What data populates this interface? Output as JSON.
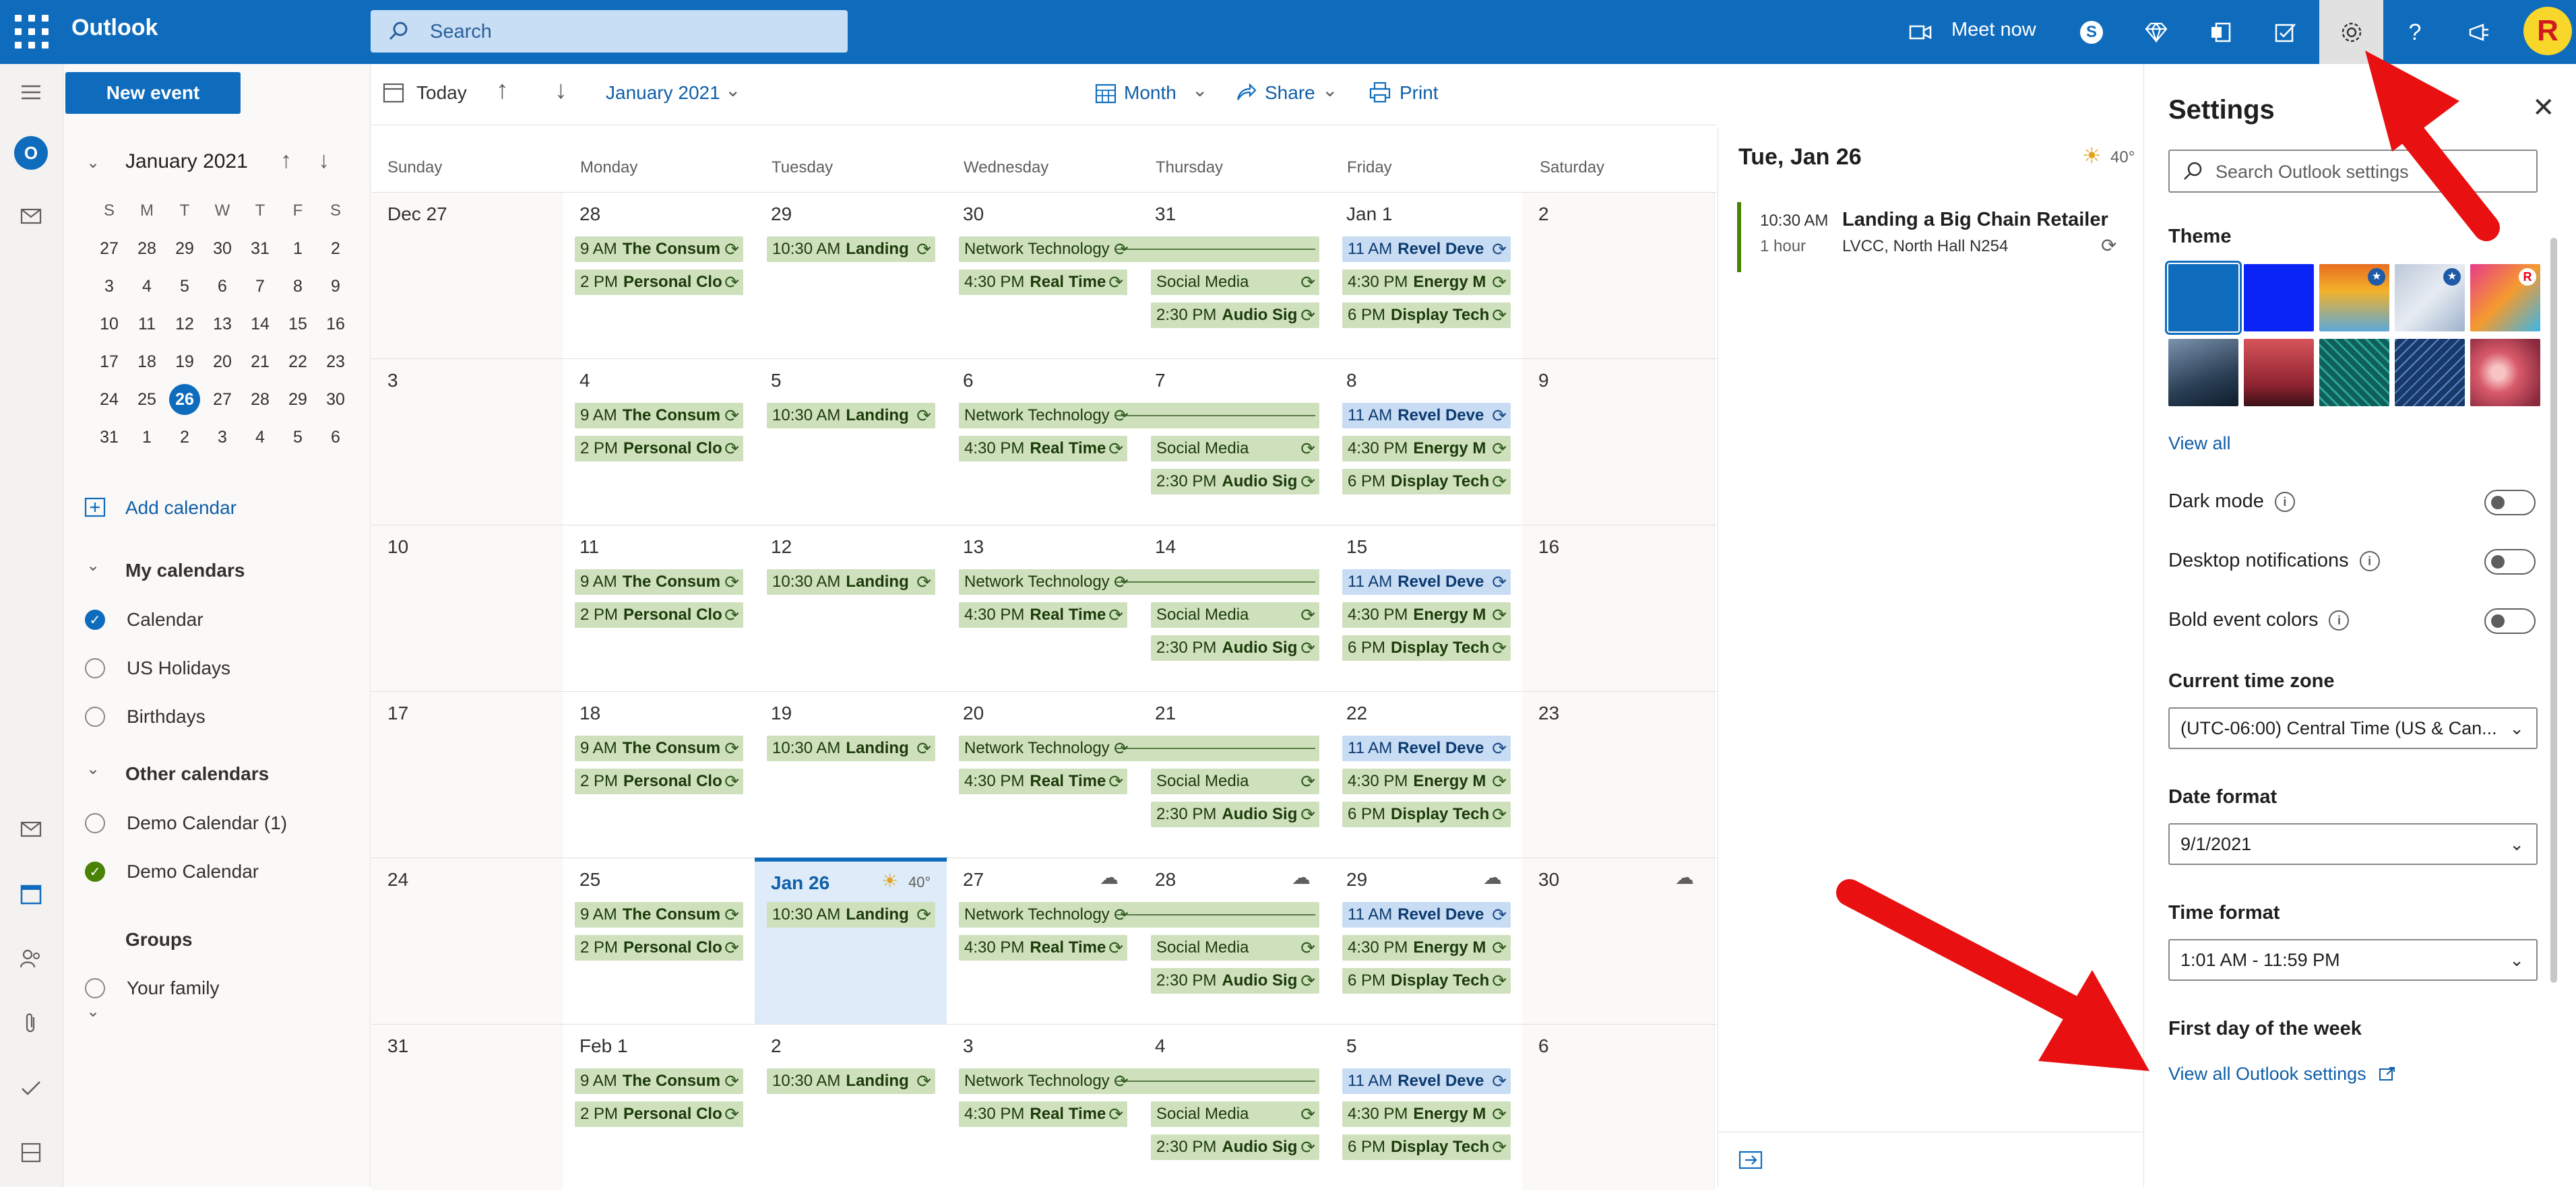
{
  "topbar": {
    "app_name": "Outlook",
    "search_placeholder": "Search",
    "meet_now": "Meet now",
    "avatar_letter": "R"
  },
  "sidebar": {
    "new_event": "New event",
    "mini_title": "January 2021",
    "mini_days": [
      "S",
      "M",
      "T",
      "W",
      "T",
      "F",
      "S"
    ],
    "mini_weeks": [
      [
        "27",
        "28",
        "29",
        "30",
        "31",
        "1",
        "2"
      ],
      [
        "3",
        "4",
        "5",
        "6",
        "7",
        "8",
        "9"
      ],
      [
        "10",
        "11",
        "12",
        "13",
        "14",
        "15",
        "16"
      ],
      [
        "17",
        "18",
        "19",
        "20",
        "21",
        "22",
        "23"
      ],
      [
        "24",
        "25",
        "26",
        "27",
        "28",
        "29",
        "30"
      ],
      [
        "31",
        "1",
        "2",
        "3",
        "4",
        "5",
        "6"
      ]
    ],
    "add_calendar": "Add calendar",
    "my_calendars": "My calendars",
    "calendar": "Calendar",
    "us_holidays": "US Holidays",
    "birthdays": "Birthdays",
    "other_calendars": "Other calendars",
    "demo_calendar_1": "Demo Calendar (1)",
    "demo_calendar": "Demo Calendar",
    "groups": "Groups",
    "your_family": "Your family"
  },
  "calendar": {
    "today": "Today",
    "month_label": "January 2021",
    "view": "Month",
    "share": "Share",
    "print": "Print",
    "days": [
      "Sunday",
      "Monday",
      "Tuesday",
      "Wednesday",
      "Thursday",
      "Friday",
      "Saturday"
    ],
    "weeks": [
      [
        "Dec 27",
        "28",
        "29",
        "30",
        "31",
        "Jan 1",
        "2"
      ],
      [
        "3",
        "4",
        "5",
        "6",
        "7",
        "8",
        "9"
      ],
      [
        "10",
        "11",
        "12",
        "13",
        "14",
        "15",
        "16"
      ],
      [
        "17",
        "18",
        "19",
        "20",
        "21",
        "22",
        "23"
      ],
      [
        "24",
        "25",
        "Jan 26",
        "27",
        "28",
        "29",
        "30"
      ],
      [
        "31",
        "Feb 1",
        "2",
        "3",
        "4",
        "5",
        "6"
      ]
    ],
    "today_weather": "40°",
    "events": {
      "mon_1_time": "9 AM",
      "mon_1_title": "The Consum",
      "mon_2_time": "2 PM",
      "mon_2_title": "Personal Clo",
      "tue_1_time": "10:30 AM",
      "tue_1_title": "Landing",
      "wed_1_title": "Network Technology",
      "wed_2_time": "4:30 PM",
      "wed_2_title": "Real Time",
      "thu_1_title": "Social Media",
      "thu_2_time": "2:30 PM",
      "thu_2_title": "Audio Sig",
      "fri_1_time": "11 AM",
      "fri_1_title": "Revel Deve",
      "fri_2_time": "4:30 PM",
      "fri_2_title": "Energy M",
      "fri_3_time": "6 PM",
      "fri_3_title": "Display Tech"
    }
  },
  "daypane": {
    "title": "Tue, Jan 26",
    "weather": "40°",
    "event_time": "10:30 AM",
    "event_duration": "1 hour",
    "event_title": "Landing a Big Chain Retailer",
    "event_location": "LVCC, North Hall N254"
  },
  "settings": {
    "title": "Settings",
    "search_placeholder": "Search Outlook settings",
    "theme": "Theme",
    "view_all": "View all",
    "dark_mode": "Dark mode",
    "desktop_notifications": "Desktop notifications",
    "bold_event_colors": "Bold event colors",
    "time_zone_label": "Current time zone",
    "time_zone_value": "(UTC-06:00) Central Time (US & Can...",
    "date_format_label": "Date format",
    "date_format_value": "9/1/2021",
    "time_format_label": "Time format",
    "time_format_value": "1:01 AM - 11:59 PM",
    "first_day_label": "First day of the week",
    "view_all_settings": "View all Outlook settings"
  },
  "colors": {
    "brand": "#0f6cbd",
    "event_green": "#cfe0bd",
    "event_blue": "#c8dcf3",
    "annotation_arrow": "#e81010"
  }
}
